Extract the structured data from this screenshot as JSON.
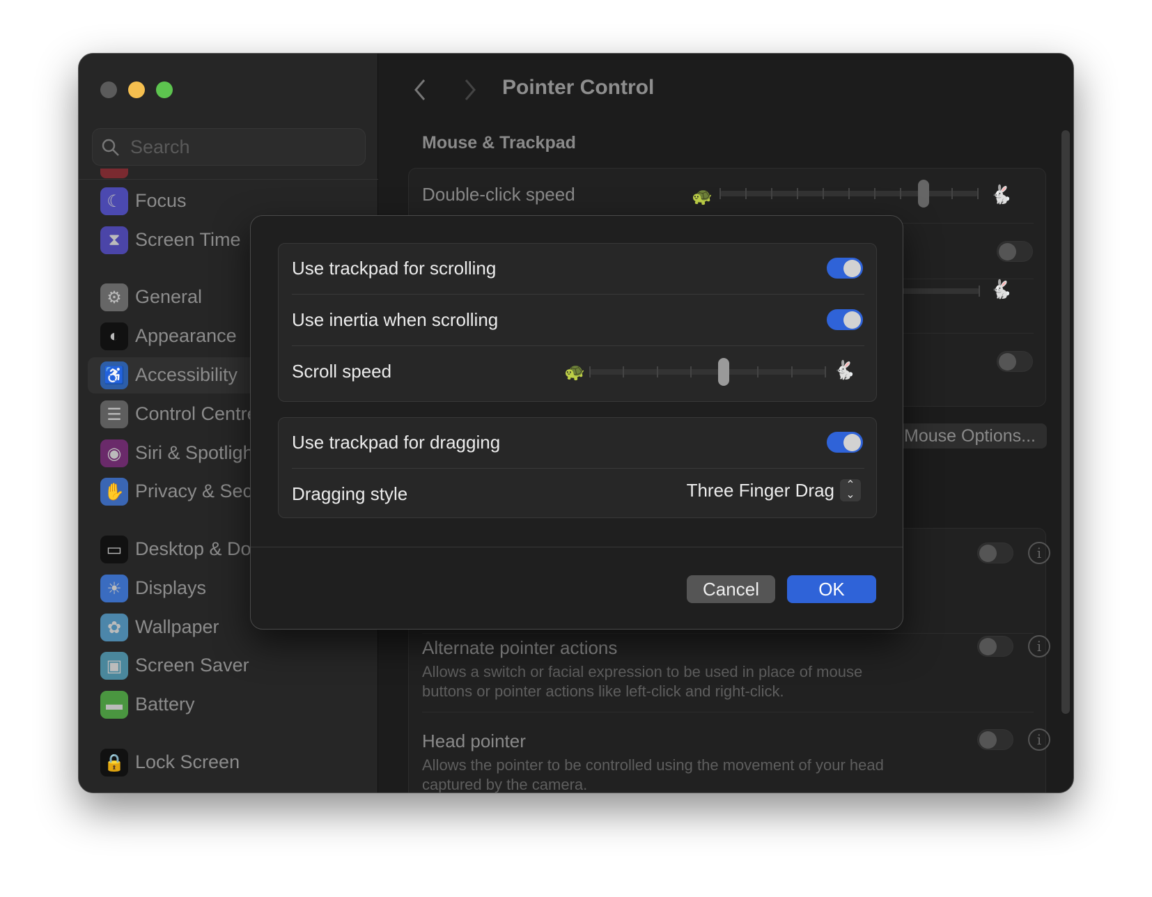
{
  "window": {
    "traffic_lights": {
      "close": "#5b5b5b",
      "minimize": "#f5bf4f",
      "zoom": "#5dc44f"
    }
  },
  "sidebar": {
    "search_placeholder": "Search",
    "selected": "Accessibility",
    "items": [
      {
        "label": "Focus",
        "icon": "moon-icon",
        "color": "#4b49b0",
        "glyph": "☾"
      },
      {
        "label": "Screen Time",
        "icon": "hourglass-icon",
        "color": "#4b45a8",
        "glyph": "⧗"
      },
      {
        "label": "General",
        "icon": "gear-icon",
        "color": "#666666",
        "glyph": "⚙"
      },
      {
        "label": "Appearance",
        "icon": "appearance-icon",
        "color": "#111111",
        "glyph": "◐"
      },
      {
        "label": "Accessibility",
        "icon": "accessibility-icon",
        "color": "#2d5ea8",
        "glyph": "♿"
      },
      {
        "label": "Control Centre",
        "icon": "switches-icon",
        "color": "#5e5e5e",
        "glyph": "☰"
      },
      {
        "label": "Siri & Spotlight",
        "icon": "siri-icon",
        "color": "#6a2a6a",
        "glyph": "◉"
      },
      {
        "label": "Privacy & Security",
        "icon": "hand-icon",
        "color": "#3a66b4",
        "glyph": "✋"
      },
      {
        "label": "Desktop & Dock",
        "icon": "dock-icon",
        "color": "#111111",
        "glyph": "▭"
      },
      {
        "label": "Displays",
        "icon": "sun-icon",
        "color": "#3a6cc0",
        "glyph": "☀"
      },
      {
        "label": "Wallpaper",
        "icon": "flower-icon",
        "color": "#4c86aa",
        "glyph": "✿"
      },
      {
        "label": "Screen Saver",
        "icon": "screensaver-icon",
        "color": "#4a879c",
        "glyph": "▣"
      },
      {
        "label": "Battery",
        "icon": "battery-icon",
        "color": "#4a9640",
        "glyph": "▬"
      },
      {
        "label": "Lock Screen",
        "icon": "lock-icon",
        "color": "#111111",
        "glyph": "🔒"
      }
    ]
  },
  "header": {
    "title": "Pointer Control"
  },
  "main": {
    "section_title": "Mouse & Trackpad",
    "double_click_label": "Double-click speed",
    "double_click_value": 0.8,
    "row2_toggle_on": false,
    "row4_toggle_on": false,
    "mouse_options_label": "Mouse Options...",
    "alternate_title": "Alternate pointer actions",
    "alternate_desc": "Allows a switch or facial expression to be used in place of mouse buttons or pointer actions like left-click and right-click.",
    "head_title": "Head pointer",
    "head_desc": "Allows the pointer to be controlled using the movement of your head captured by the camera.",
    "info_glyph": "i"
  },
  "dialog": {
    "rows": {
      "scrolling": {
        "label": "Use trackpad for scrolling",
        "on": true
      },
      "inertia": {
        "label": "Use inertia when scrolling",
        "on": true
      },
      "scroll_speed": {
        "label": "Scroll speed",
        "value": 0.571
      },
      "dragging": {
        "label": "Use trackpad for dragging",
        "on": true
      },
      "drag_style": {
        "label": "Dragging style",
        "value": "Three Finger Drag"
      }
    },
    "cancel_label": "Cancel",
    "ok_label": "OK",
    "accent": "#2f63d8"
  }
}
